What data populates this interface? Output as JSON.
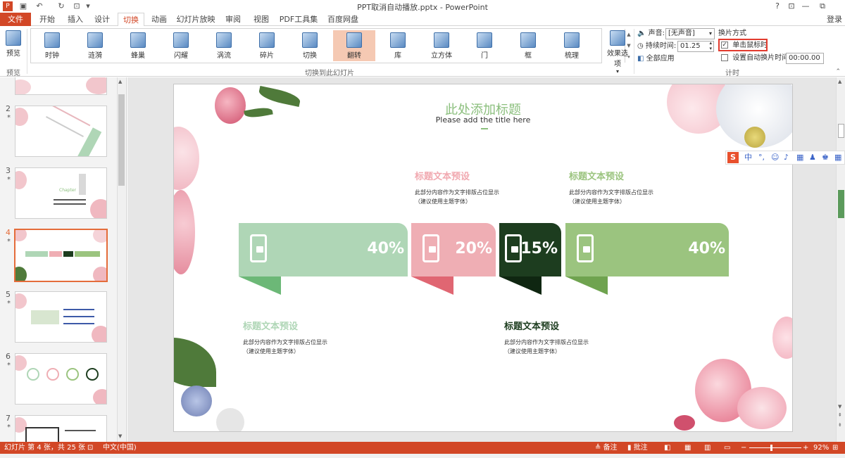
{
  "window": {
    "title": "PPT取消自动播放.pptx - PowerPoint",
    "controls": [
      "?",
      "⊡",
      "—",
      "⧉"
    ]
  },
  "tabs": [
    "文件",
    "开始",
    "插入",
    "设计",
    "切换",
    "动画",
    "幻灯片放映",
    "审阅",
    "视图",
    "PDF工具集",
    "百度网盘"
  ],
  "login_label": "登录",
  "ribbon": {
    "preview_label": "预览",
    "preview_group_label": "预览",
    "transitions": [
      "时钟",
      "涟漪",
      "蜂巢",
      "闪耀",
      "涡流",
      "碎片",
      "切换",
      "翻转",
      "库",
      "立方体",
      "门",
      "框",
      "梳理"
    ],
    "selected_transition": "翻转",
    "effect_options_label": "效果选项",
    "transition_group_label": "切换到此幻灯片",
    "sound_label": "声音:",
    "sound_value": "[无声音]",
    "duration_label": "持续时间:",
    "duration_value": "01.25",
    "apply_all_label": "全部应用",
    "advance_label": "换片方式",
    "on_click_label": "单击鼠标时",
    "on_click_checked": true,
    "after_label": "设置自动换片时间:",
    "after_checked": false,
    "after_value": "00:00.00",
    "timing_group_label": "计时"
  },
  "thumbnails": [
    {
      "num": "2",
      "star": "*"
    },
    {
      "num": "3",
      "star": "*"
    },
    {
      "num": "4",
      "star": "*"
    },
    {
      "num": "5",
      "star": "*"
    },
    {
      "num": "6",
      "star": "*"
    },
    {
      "num": "7",
      "star": "*"
    }
  ],
  "thumb_text": {
    "chapter": "Chapter",
    "p40": "40%",
    "p20": "20%",
    "p15": "15%"
  },
  "slide": {
    "title": "此处添加标题",
    "subtitle": "Please add the title here",
    "cards": [
      {
        "pct": "40%",
        "color": "#afd6b6",
        "tail_color": "#6cb877"
      },
      {
        "pct": "20%",
        "color": "#efaeb4",
        "tail_color": "#e06672"
      },
      {
        "pct": "15%",
        "color": "#1d3d1f",
        "tail_color": "#0f2611"
      },
      {
        "pct": "40%",
        "color": "#9bc47f",
        "tail_color": "#6fa34f"
      }
    ],
    "blocks": [
      {
        "heading": "标题文本预设",
        "line1": "此部分内容作为文字排版占位显示",
        "line2": "（建议使用主题字体）",
        "color": "#f1a9b0"
      },
      {
        "heading": "标题文本预设",
        "line1": "此部分内容作为文字排版占位显示",
        "line2": "（建议使用主题字体）",
        "color": "#9bc47f"
      },
      {
        "heading": "标题文本预设",
        "line1": "此部分内容作为文字排版占位显示",
        "line2": "（建议使用主题字体）",
        "color": "#afd6b6"
      },
      {
        "heading": "标题文本预设",
        "line1": "此部分内容作为文字排版占位显示",
        "line2": "（建议使用主题字体）",
        "color": "#1d3d1f"
      }
    ]
  },
  "ime_bar": [
    "S",
    "中",
    "°,",
    "☺",
    "♪",
    "▦",
    "♟",
    "♚",
    "▦"
  ],
  "status": {
    "slide_info": "幻灯片 第 4 张，共 25 张",
    "language": "中文(中国)",
    "notes_label": "备注",
    "comments_label": "批注",
    "zoom": "92%",
    "zoom_minus": "−",
    "zoom_plus": "+"
  },
  "colors": {
    "accent": "#d24726",
    "highlight": "#e23b2e"
  }
}
